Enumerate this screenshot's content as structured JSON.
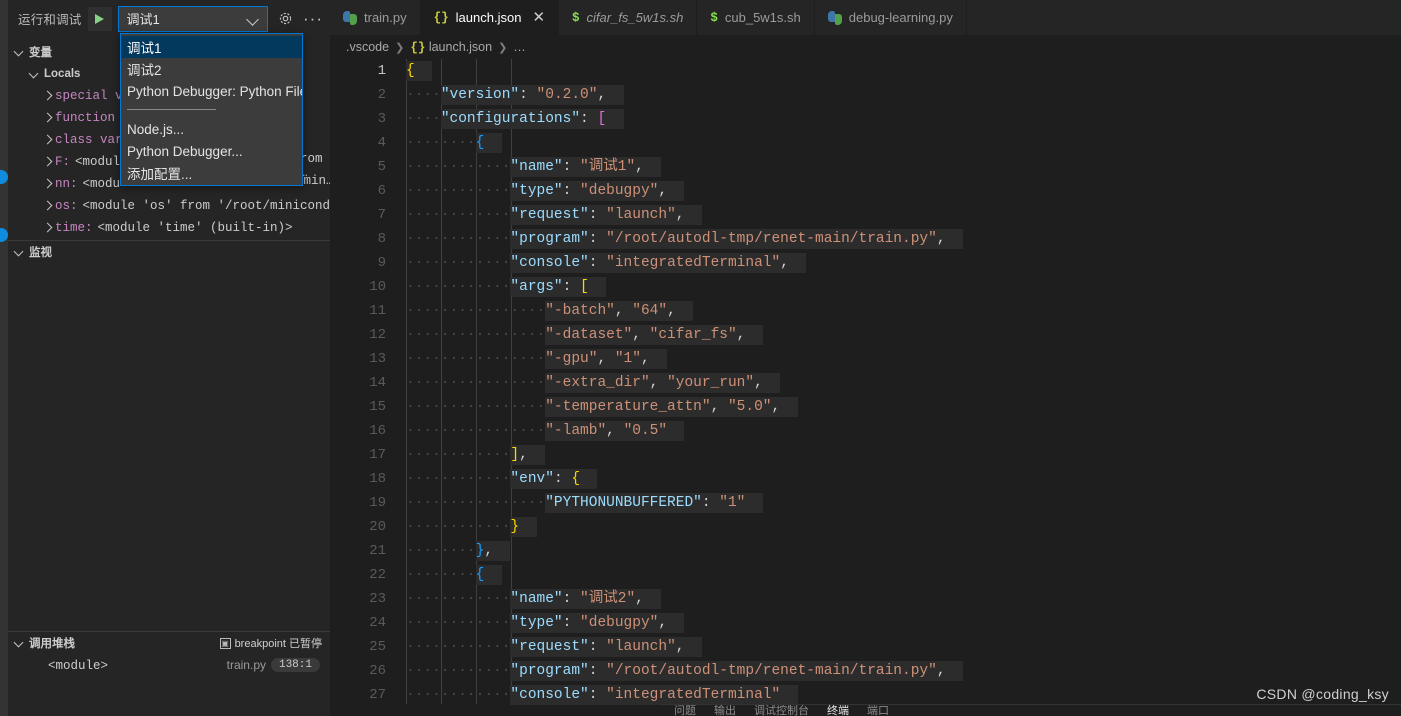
{
  "colors": {
    "accent": "#0078d4",
    "editor_bg": "#1e1e1e",
    "panel_bg": "#252526",
    "selection_bg": "#04395e",
    "string": "#ce9178",
    "key": "#9cdcfe",
    "play_green": "#89d185"
  },
  "activity_bar": {
    "badges": 2
  },
  "debug_panel": {
    "toolbar": {
      "title": "运行和调试",
      "run_icon": "play-icon",
      "selected_config": "调试1",
      "chevron_icon": "chevron-down-icon",
      "settings_icon": "gear-icon",
      "more_icon": "ellipsis-icon"
    },
    "dropdown": {
      "open": true,
      "items": [
        {
          "label": "调试1",
          "selected": true
        },
        {
          "label": "调试2",
          "selected": false
        },
        {
          "label": "Python Debugger: Python File",
          "selected": false
        },
        {
          "separator": true
        },
        {
          "label": "Node.js...",
          "selected": false
        },
        {
          "label": "Python Debugger...",
          "selected": false
        },
        {
          "label": "添加配置...",
          "selected": false
        }
      ]
    },
    "variables": {
      "header": "变量",
      "scope": "Locals",
      "rows": [
        {
          "name": "special v",
          "value": ""
        },
        {
          "name": "function",
          "value": ""
        },
        {
          "name": "class var",
          "value": ""
        },
        {
          "name": "F:",
          "value": "<modul"
        },
        {
          "name": "nn:",
          "value": "<modu"
        },
        {
          "name": "os:",
          "value": "<module 'os' from '/root/miniconda…"
        },
        {
          "name": "time:",
          "value": "<module 'time' (built-in)>"
        }
      ],
      "clipped_right": [
        "rom …",
        "/min…"
      ]
    },
    "watch": {
      "header": "监视"
    },
    "call_stack": {
      "header": "调用堆栈",
      "status_icon": "breakpoint-icon",
      "status_text": "breakpoint 已暂停",
      "frame": "<module>",
      "file": "train.py",
      "position": "138:1"
    }
  },
  "editor": {
    "tabs": [
      {
        "label": "train.py",
        "icon": "python-icon",
        "active": false,
        "italic": false,
        "closable": false
      },
      {
        "label": "launch.json",
        "icon": "json-icon",
        "active": true,
        "italic": false,
        "closable": true
      },
      {
        "label": "cifar_fs_5w1s.sh",
        "icon": "shell-icon",
        "active": false,
        "italic": true,
        "closable": false
      },
      {
        "label": "cub_5w1s.sh",
        "icon": "shell-icon",
        "active": false,
        "italic": false,
        "closable": false
      },
      {
        "label": "debug-learning.py",
        "icon": "python-icon",
        "active": false,
        "italic": false,
        "closable": false
      }
    ],
    "close_icon": "close-icon",
    "breadcrumb": [
      ".vscode",
      "{} launch.json",
      "…"
    ],
    "active_line": 1,
    "lines": [
      {
        "n": 1,
        "indent": 0,
        "tokens": [
          {
            "t": "{",
            "c": "br-y"
          }
        ]
      },
      {
        "n": 2,
        "indent": 1,
        "tokens": [
          {
            "t": "\"version\"",
            "c": "key"
          },
          {
            "t": ": ",
            "c": "punc"
          },
          {
            "t": "\"0.2.0\"",
            "c": "str"
          },
          {
            "t": ",",
            "c": "punc"
          }
        ]
      },
      {
        "n": 3,
        "indent": 1,
        "tokens": [
          {
            "t": "\"configurations\"",
            "c": "key"
          },
          {
            "t": ": ",
            "c": "punc"
          },
          {
            "t": "[",
            "c": "br-p"
          }
        ]
      },
      {
        "n": 4,
        "indent": 2,
        "tokens": [
          {
            "t": "{",
            "c": "br-b"
          }
        ]
      },
      {
        "n": 5,
        "indent": 3,
        "tokens": [
          {
            "t": "\"name\"",
            "c": "key"
          },
          {
            "t": ": ",
            "c": "punc"
          },
          {
            "t": "\"调试1\"",
            "c": "str"
          },
          {
            "t": ",",
            "c": "punc"
          }
        ]
      },
      {
        "n": 6,
        "indent": 3,
        "tokens": [
          {
            "t": "\"type\"",
            "c": "key"
          },
          {
            "t": ": ",
            "c": "punc"
          },
          {
            "t": "\"debugpy\"",
            "c": "str"
          },
          {
            "t": ",",
            "c": "punc"
          }
        ]
      },
      {
        "n": 7,
        "indent": 3,
        "tokens": [
          {
            "t": "\"request\"",
            "c": "key"
          },
          {
            "t": ": ",
            "c": "punc"
          },
          {
            "t": "\"launch\"",
            "c": "str"
          },
          {
            "t": ",",
            "c": "punc"
          }
        ]
      },
      {
        "n": 8,
        "indent": 3,
        "tokens": [
          {
            "t": "\"program\"",
            "c": "key"
          },
          {
            "t": ": ",
            "c": "punc"
          },
          {
            "t": "\"/root/autodl-tmp/renet-main/train.py\"",
            "c": "str"
          },
          {
            "t": ",",
            "c": "punc"
          }
        ]
      },
      {
        "n": 9,
        "indent": 3,
        "tokens": [
          {
            "t": "\"console\"",
            "c": "key"
          },
          {
            "t": ": ",
            "c": "punc"
          },
          {
            "t": "\"integratedTerminal\"",
            "c": "str"
          },
          {
            "t": ",",
            "c": "punc"
          }
        ]
      },
      {
        "n": 10,
        "indent": 3,
        "tokens": [
          {
            "t": "\"args\"",
            "c": "key"
          },
          {
            "t": ": ",
            "c": "punc"
          },
          {
            "t": "[",
            "c": "br-y"
          }
        ]
      },
      {
        "n": 11,
        "indent": 4,
        "tokens": [
          {
            "t": "\"-batch\"",
            "c": "str"
          },
          {
            "t": ", ",
            "c": "punc"
          },
          {
            "t": "\"64\"",
            "c": "str"
          },
          {
            "t": ",",
            "c": "punc"
          }
        ]
      },
      {
        "n": 12,
        "indent": 4,
        "tokens": [
          {
            "t": "\"-dataset\"",
            "c": "str"
          },
          {
            "t": ", ",
            "c": "punc"
          },
          {
            "t": "\"cifar_fs\"",
            "c": "str"
          },
          {
            "t": ",",
            "c": "punc"
          }
        ]
      },
      {
        "n": 13,
        "indent": 4,
        "tokens": [
          {
            "t": "\"-gpu\"",
            "c": "str"
          },
          {
            "t": ", ",
            "c": "punc"
          },
          {
            "t": "\"1\"",
            "c": "str"
          },
          {
            "t": ",",
            "c": "punc"
          }
        ]
      },
      {
        "n": 14,
        "indent": 4,
        "tokens": [
          {
            "t": "\"-extra_dir\"",
            "c": "str"
          },
          {
            "t": ", ",
            "c": "punc"
          },
          {
            "t": "\"your_run\"",
            "c": "str"
          },
          {
            "t": ",",
            "c": "punc"
          }
        ]
      },
      {
        "n": 15,
        "indent": 4,
        "tokens": [
          {
            "t": "\"-temperature_attn\"",
            "c": "str"
          },
          {
            "t": ", ",
            "c": "punc"
          },
          {
            "t": "\"5.0\"",
            "c": "str"
          },
          {
            "t": ",",
            "c": "punc"
          }
        ]
      },
      {
        "n": 16,
        "indent": 4,
        "tokens": [
          {
            "t": "\"-lamb\"",
            "c": "str"
          },
          {
            "t": ", ",
            "c": "punc"
          },
          {
            "t": "\"0.5\"",
            "c": "str"
          }
        ]
      },
      {
        "n": 17,
        "indent": 3,
        "tokens": [
          {
            "t": "]",
            "c": "br-y"
          },
          {
            "t": ",",
            "c": "punc"
          }
        ]
      },
      {
        "n": 18,
        "indent": 3,
        "tokens": [
          {
            "t": "\"env\"",
            "c": "key"
          },
          {
            "t": ": ",
            "c": "punc"
          },
          {
            "t": "{",
            "c": "br-y"
          }
        ]
      },
      {
        "n": 19,
        "indent": 4,
        "tokens": [
          {
            "t": "\"PYTHONUNBUFFERED\"",
            "c": "key"
          },
          {
            "t": ": ",
            "c": "punc"
          },
          {
            "t": "\"1\"",
            "c": "str"
          }
        ]
      },
      {
        "n": 20,
        "indent": 3,
        "tokens": [
          {
            "t": "}",
            "c": "br-y"
          }
        ]
      },
      {
        "n": 21,
        "indent": 2,
        "tokens": [
          {
            "t": "}",
            "c": "br-b"
          },
          {
            "t": ",",
            "c": "punc"
          }
        ]
      },
      {
        "n": 22,
        "indent": 2,
        "tokens": [
          {
            "t": "{",
            "c": "br-b"
          }
        ]
      },
      {
        "n": 23,
        "indent": 3,
        "tokens": [
          {
            "t": "\"name\"",
            "c": "key"
          },
          {
            "t": ": ",
            "c": "punc"
          },
          {
            "t": "\"调试2\"",
            "c": "str"
          },
          {
            "t": ",",
            "c": "punc"
          }
        ]
      },
      {
        "n": 24,
        "indent": 3,
        "tokens": [
          {
            "t": "\"type\"",
            "c": "key"
          },
          {
            "t": ": ",
            "c": "punc"
          },
          {
            "t": "\"debugpy\"",
            "c": "str"
          },
          {
            "t": ",",
            "c": "punc"
          }
        ]
      },
      {
        "n": 25,
        "indent": 3,
        "tokens": [
          {
            "t": "\"request\"",
            "c": "key"
          },
          {
            "t": ": ",
            "c": "punc"
          },
          {
            "t": "\"launch\"",
            "c": "str"
          },
          {
            "t": ",",
            "c": "punc"
          }
        ]
      },
      {
        "n": 26,
        "indent": 3,
        "tokens": [
          {
            "t": "\"program\"",
            "c": "key"
          },
          {
            "t": ": ",
            "c": "punc"
          },
          {
            "t": "\"/root/autodl-tmp/renet-main/train.py\"",
            "c": "str"
          },
          {
            "t": ",",
            "c": "punc"
          }
        ]
      },
      {
        "n": 27,
        "indent": 3,
        "tokens": [
          {
            "t": "\"console\"",
            "c": "key"
          },
          {
            "t": ": ",
            "c": "punc"
          },
          {
            "t": "\"integratedTerminal\"",
            "c": "str"
          }
        ]
      }
    ]
  },
  "bottom_panel": {
    "tabs": [
      "问题",
      "输出",
      "调试控制台",
      "终端",
      "端口"
    ],
    "active": "终端"
  },
  "watermark": "CSDN @coding_ksy"
}
